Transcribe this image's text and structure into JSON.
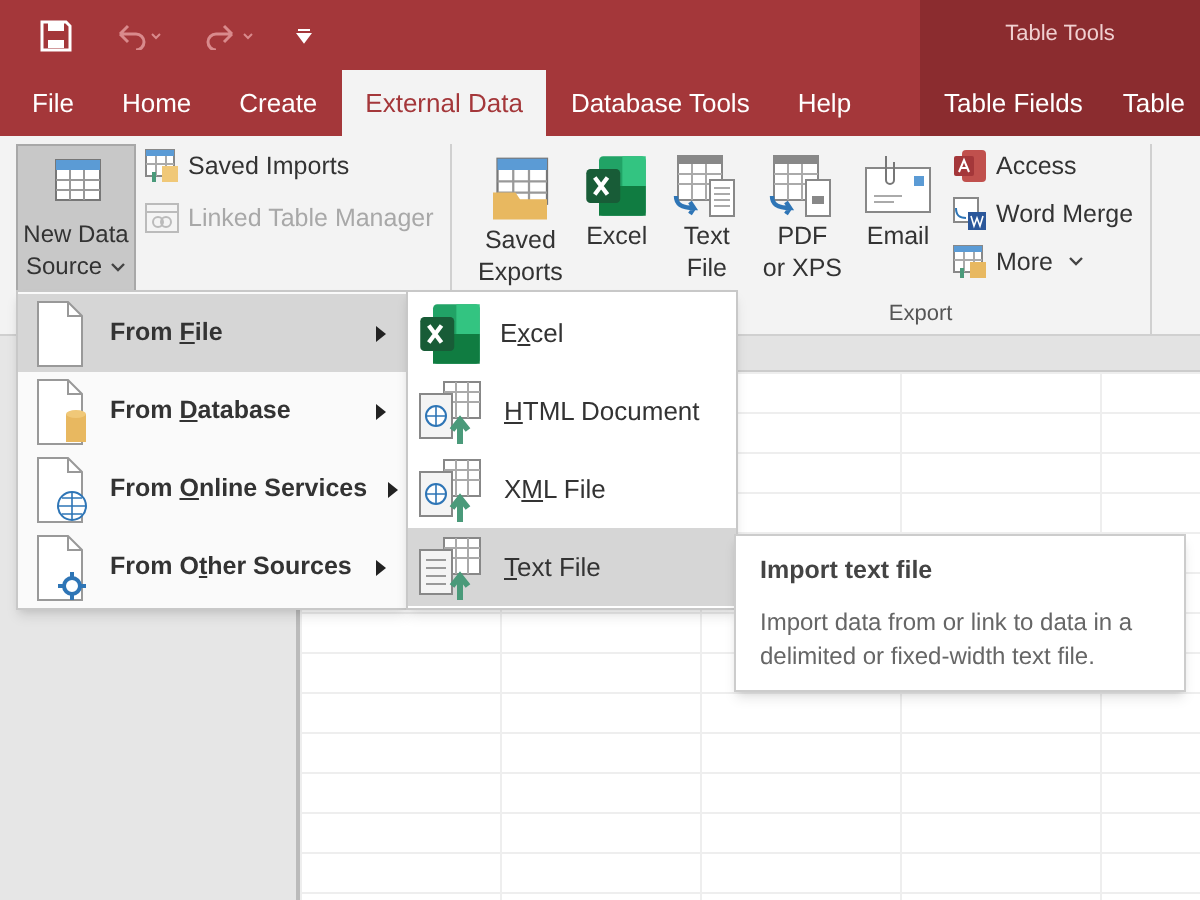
{
  "context_title": "Table Tools",
  "tabs": [
    {
      "label": "File",
      "selected": false
    },
    {
      "label": "Home",
      "selected": false
    },
    {
      "label": "Create",
      "selected": false
    },
    {
      "label": "External Data",
      "selected": true
    },
    {
      "label": "Database Tools",
      "selected": false
    },
    {
      "label": "Help",
      "selected": false
    }
  ],
  "context_tabs": [
    {
      "label": "Table Fields",
      "selected": false
    },
    {
      "label": "Table",
      "selected": false
    }
  ],
  "import_group": {
    "big_button": {
      "lines": [
        "New Data",
        "Source"
      ],
      "pressed": true
    },
    "small_buttons": [
      {
        "kind": "saved-imports",
        "label": "Saved Imports",
        "disabled": false
      },
      {
        "kind": "linked-table",
        "label": "Linked Table Manager",
        "disabled": true
      }
    ]
  },
  "export_group": {
    "label": "Export",
    "big_buttons": [
      {
        "kind": "saved-exports",
        "lines": [
          "Saved",
          "Exports"
        ]
      },
      {
        "kind": "excel",
        "lines": [
          "Excel"
        ]
      },
      {
        "kind": "text",
        "lines": [
          "Text",
          "File"
        ]
      },
      {
        "kind": "pdf",
        "lines": [
          "PDF",
          "or XPS"
        ]
      },
      {
        "kind": "email",
        "lines": [
          "Email"
        ]
      }
    ],
    "small_buttons": [
      {
        "kind": "access",
        "label": "Access",
        "dropdown": false
      },
      {
        "kind": "word",
        "label": "Word Merge",
        "dropdown": false
      },
      {
        "kind": "more",
        "label": "More",
        "dropdown": true
      }
    ]
  },
  "menu": [
    {
      "kind": "file",
      "label": {
        "before": "From ",
        "key": "F",
        "after": "ile"
      },
      "selected": true
    },
    {
      "kind": "database",
      "label": {
        "before": "From ",
        "key": "D",
        "after": "atabase"
      },
      "selected": false
    },
    {
      "kind": "online",
      "label": {
        "before": "From ",
        "key": "O",
        "after": "nline Services"
      },
      "selected": false
    },
    {
      "kind": "other",
      "label": {
        "before": "From O",
        "key": "t",
        "after": "her Sources"
      },
      "selected": false
    }
  ],
  "submenu": [
    {
      "kind": "excel",
      "label": {
        "before": "E",
        "key": "x",
        "after": "cel"
      },
      "selected": false
    },
    {
      "kind": "html",
      "label": {
        "key": "H",
        "after": "TML Document"
      },
      "selected": false
    },
    {
      "kind": "xml",
      "label": {
        "before": "X",
        "key": "M",
        "after": "L File"
      },
      "selected": false
    },
    {
      "kind": "text",
      "label": {
        "key": "T",
        "after": "ext File"
      },
      "selected": true
    }
  ],
  "tooltip": {
    "title": "Import text file",
    "body": "Import data from or link to data in a delimited or fixed-width text file."
  }
}
